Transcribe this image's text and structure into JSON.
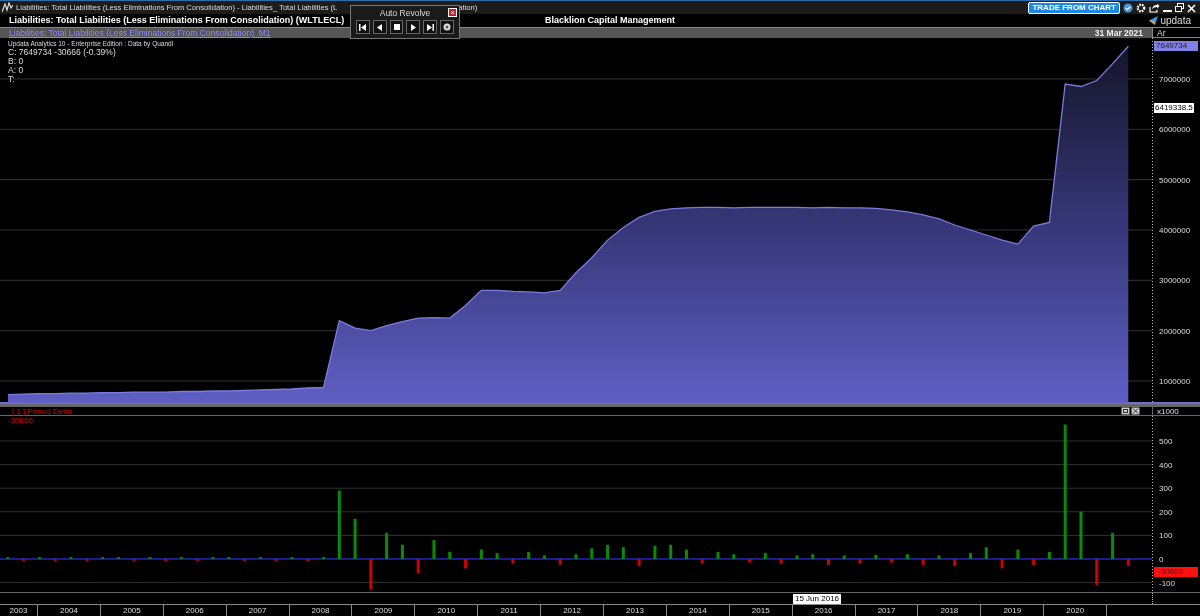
{
  "title_bar": {
    "title": "Liabilities: Total Liabilities (Less Eliminations From Consolidation) - Liabilities_ Total Liabilities (L",
    "title_tail": "ation)",
    "trade_button": "TRADE FROM CHART"
  },
  "header": {
    "instrument": "Liabilities: Total Liabilities (Less Eliminations From Consolidation) (WLTLECL)",
    "company": "Blacklion Capital Management",
    "logo": "updata"
  },
  "auto_revolve": {
    "title": "Auto Revolve",
    "close": "×"
  },
  "main_pane": {
    "date": "31 Mar 2021",
    "axis_header": "Ar",
    "info": [
      "Updata Analytics 10 - Enterprise Edition : Data by Quandl",
      "C: 7649734  -30666 (-0.39%)",
      "B: 0",
      "A: 0",
      "T:"
    ],
    "last_tag": "7649734",
    "cursor_tag": "6419338.5",
    "chart_data": {
      "type": "area",
      "categories": [
        null,
        null,
        null,
        null,
        null,
        null,
        null,
        null,
        null,
        null,
        null,
        null,
        null,
        null,
        null,
        null,
        null,
        null,
        null,
        null,
        null,
        null,
        null,
        null,
        null,
        null,
        null,
        null,
        null,
        null,
        null,
        null,
        null,
        null,
        null,
        null,
        null,
        null,
        null,
        null,
        null,
        null,
        null,
        null,
        null,
        null,
        null,
        null,
        null,
        null,
        null,
        null,
        null,
        null,
        null,
        null,
        null,
        null,
        null,
        null,
        null,
        null,
        null,
        null,
        null,
        null,
        null,
        null,
        null,
        null,
        null,
        null,
        null
      ],
      "series": [
        {
          "name": "Liabilities: Total Liabilities (Less Eliminations From Consolidation)  M1",
          "color": "#7b7be0",
          "values": [
            730000,
            740000,
            750000,
            750000,
            760000,
            760000,
            770000,
            770000,
            780000,
            780000,
            780000,
            790000,
            790000,
            800000,
            800000,
            810000,
            820000,
            830000,
            840000,
            860000,
            870000,
            2200000,
            2050000,
            2000000,
            2100000,
            2180000,
            2250000,
            2260000,
            2250000,
            2500000,
            2800000,
            2800000,
            2780000,
            2770000,
            2750000,
            2800000,
            3150000,
            3450000,
            3800000,
            4050000,
            4250000,
            4370000,
            4420000,
            4440000,
            4450000,
            4450000,
            4440000,
            4450000,
            4450000,
            4450000,
            4450000,
            4440000,
            4450000,
            4440000,
            4440000,
            4430000,
            4400000,
            4360000,
            4300000,
            4220000,
            4100000,
            4000000,
            3900000,
            3800000,
            3720000,
            4080000,
            4150000,
            6900000,
            6850000,
            6970000,
            7300000,
            7650000,
            null
          ]
        }
      ],
      "grid": true,
      "ylim": [
        562500,
        7814600
      ],
      "yticks": [
        1000000,
        2000000,
        3000000,
        4000000,
        5000000,
        6000000,
        7000000
      ]
    }
  },
  "delta_pane": {
    "value": "-30666",
    "axis_header": "x1000",
    "last_tag": "-30666",
    "chart_data": {
      "type": "bar",
      "stacked": true,
      "categories": [
        null,
        null,
        null,
        null,
        null,
        null,
        null,
        null,
        null,
        null,
        null,
        null,
        null,
        null,
        null,
        null,
        null,
        null,
        null,
        null,
        null,
        null,
        null,
        null,
        null,
        null,
        null,
        null,
        null,
        null,
        null,
        null,
        null,
        null,
        null,
        null,
        null,
        null,
        null,
        null,
        null,
        null,
        null,
        null,
        null,
        null,
        null,
        null,
        null,
        null,
        null,
        null,
        null,
        null,
        null,
        null,
        null,
        null,
        null,
        null,
        null,
        null,
        null,
        null,
        null,
        null,
        null,
        null,
        null,
        null,
        null,
        null,
        null
      ],
      "series": [
        {
          "name": "[ 1 ] Period Delta",
          "color": "#0a8a0a",
          "values": [
            8,
            null,
            8,
            null,
            8,
            null,
            8,
            8,
            null,
            8,
            null,
            8,
            null,
            8,
            8,
            null,
            8,
            null,
            8,
            null,
            8,
            290,
            170,
            null,
            110,
            60,
            null,
            80,
            30,
            null,
            40,
            25,
            null,
            30,
            15,
            null,
            20,
            45,
            60,
            50,
            null,
            55,
            60,
            40,
            null,
            30,
            20,
            null,
            25,
            null,
            15,
            20,
            null,
            15,
            null,
            18,
            null,
            20,
            null,
            15,
            null,
            25,
            50,
            null,
            40,
            null,
            30,
            570,
            200,
            null,
            110,
            null,
            null
          ]
        },
        {
          "color": "#d00000",
          "values": [
            null,
            -8,
            null,
            -8,
            null,
            -8,
            null,
            null,
            -8,
            null,
            -8,
            null,
            -8,
            null,
            null,
            -8,
            null,
            -8,
            null,
            -8,
            null,
            null,
            null,
            -130,
            null,
            null,
            -60,
            null,
            null,
            -40,
            null,
            null,
            -20,
            null,
            null,
            -25,
            null,
            null,
            null,
            null,
            -30,
            null,
            null,
            null,
            -20,
            null,
            null,
            -15,
            null,
            -20,
            null,
            null,
            -25,
            null,
            -20,
            null,
            -15,
            null,
            -25,
            null,
            -30,
            null,
            null,
            -40,
            null,
            -25,
            null,
            null,
            null,
            -110,
            null,
            -30,
            null
          ]
        }
      ],
      "ref_lines": [
        {
          "axis": "y",
          "value": 0,
          "color": "#2020ff"
        }
      ],
      "grid": true,
      "ylim": [
        -140,
        606
      ],
      "yticks": [
        -100,
        0,
        100,
        200,
        300,
        400,
        500
      ]
    }
  },
  "time_axis": {
    "years": [
      "2003",
      "2004",
      "2005",
      "2006",
      "2007",
      "2008",
      "2009",
      "2010",
      "2011",
      "2012",
      "2013",
      "2014",
      "2015",
      "2016",
      "2017",
      "2018",
      "2019",
      "2020"
    ],
    "cursor_date": "15 Jun 2016"
  }
}
